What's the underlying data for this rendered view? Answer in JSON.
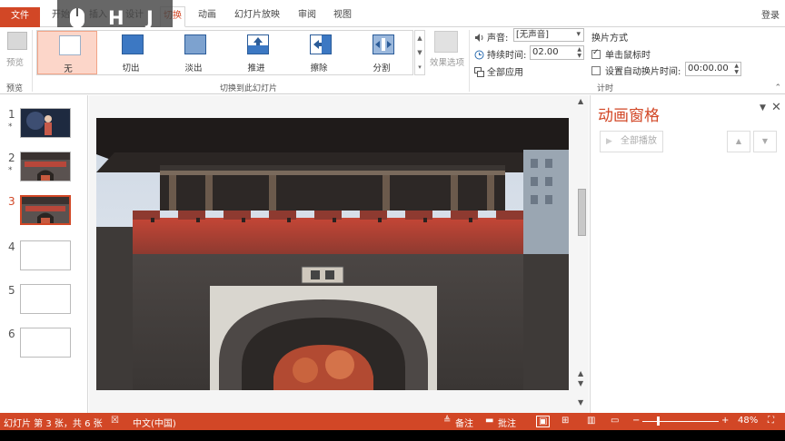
{
  "tabs": {
    "file": "文件",
    "home": "开始",
    "insert": "插入",
    "design": "设计",
    "transitions": "切换",
    "animations": "动画",
    "slideshow": "幻灯片放映",
    "review": "审阅",
    "view": "视图",
    "signin": "登录"
  },
  "key_overlay": {
    "keys": [
      "H",
      "J"
    ],
    "mouse": "mouse-icon"
  },
  "ribbon": {
    "preview": {
      "label": "预览",
      "group": "预览"
    },
    "transitions_group": "切换到此幻灯片",
    "gallery": [
      {
        "label": "无",
        "icon": "none-transition-icon",
        "selected": true
      },
      {
        "label": "切出",
        "icon": "cut-transition-icon"
      },
      {
        "label": "淡出",
        "icon": "fade-transition-icon"
      },
      {
        "label": "推进",
        "icon": "push-transition-icon"
      },
      {
        "label": "擦除",
        "icon": "wipe-transition-icon"
      },
      {
        "label": "分割",
        "icon": "split-transition-icon"
      }
    ],
    "effect_options": "效果选项",
    "timing": {
      "sound_label": "声音:",
      "sound_value": "[无声音]",
      "duration_label": "持续时间:",
      "duration_value": "02.00",
      "apply_all": "全部应用",
      "advance_title": "换片方式",
      "on_click": "单击鼠标时",
      "on_click_checked": true,
      "after_label": "设置自动换片时间:",
      "after_value": "00:00.00",
      "after_checked": false,
      "group": "计时"
    }
  },
  "slides": [
    {
      "number": "1",
      "star": "*",
      "thumb": "portrait-slide"
    },
    {
      "number": "2",
      "star": "*",
      "thumb": "gate-slide"
    },
    {
      "number": "3",
      "star": "",
      "thumb": "gate-slide",
      "active": true
    },
    {
      "number": "4",
      "star": "",
      "thumb": "blank"
    },
    {
      "number": "5",
      "star": "",
      "thumb": "blank"
    },
    {
      "number": "6",
      "star": "",
      "thumb": "blank"
    }
  ],
  "anim_pane": {
    "title": "动画窗格",
    "play_all": "全部播放"
  },
  "status": {
    "slide_info": "幻灯片 第 3 张，共 6 张",
    "language": "中文(中国)",
    "notes": "备注",
    "comments": "批注",
    "zoom": "48%"
  },
  "colors": {
    "accent": "#d24726",
    "ribbon_selected": "#fcd6c9"
  }
}
